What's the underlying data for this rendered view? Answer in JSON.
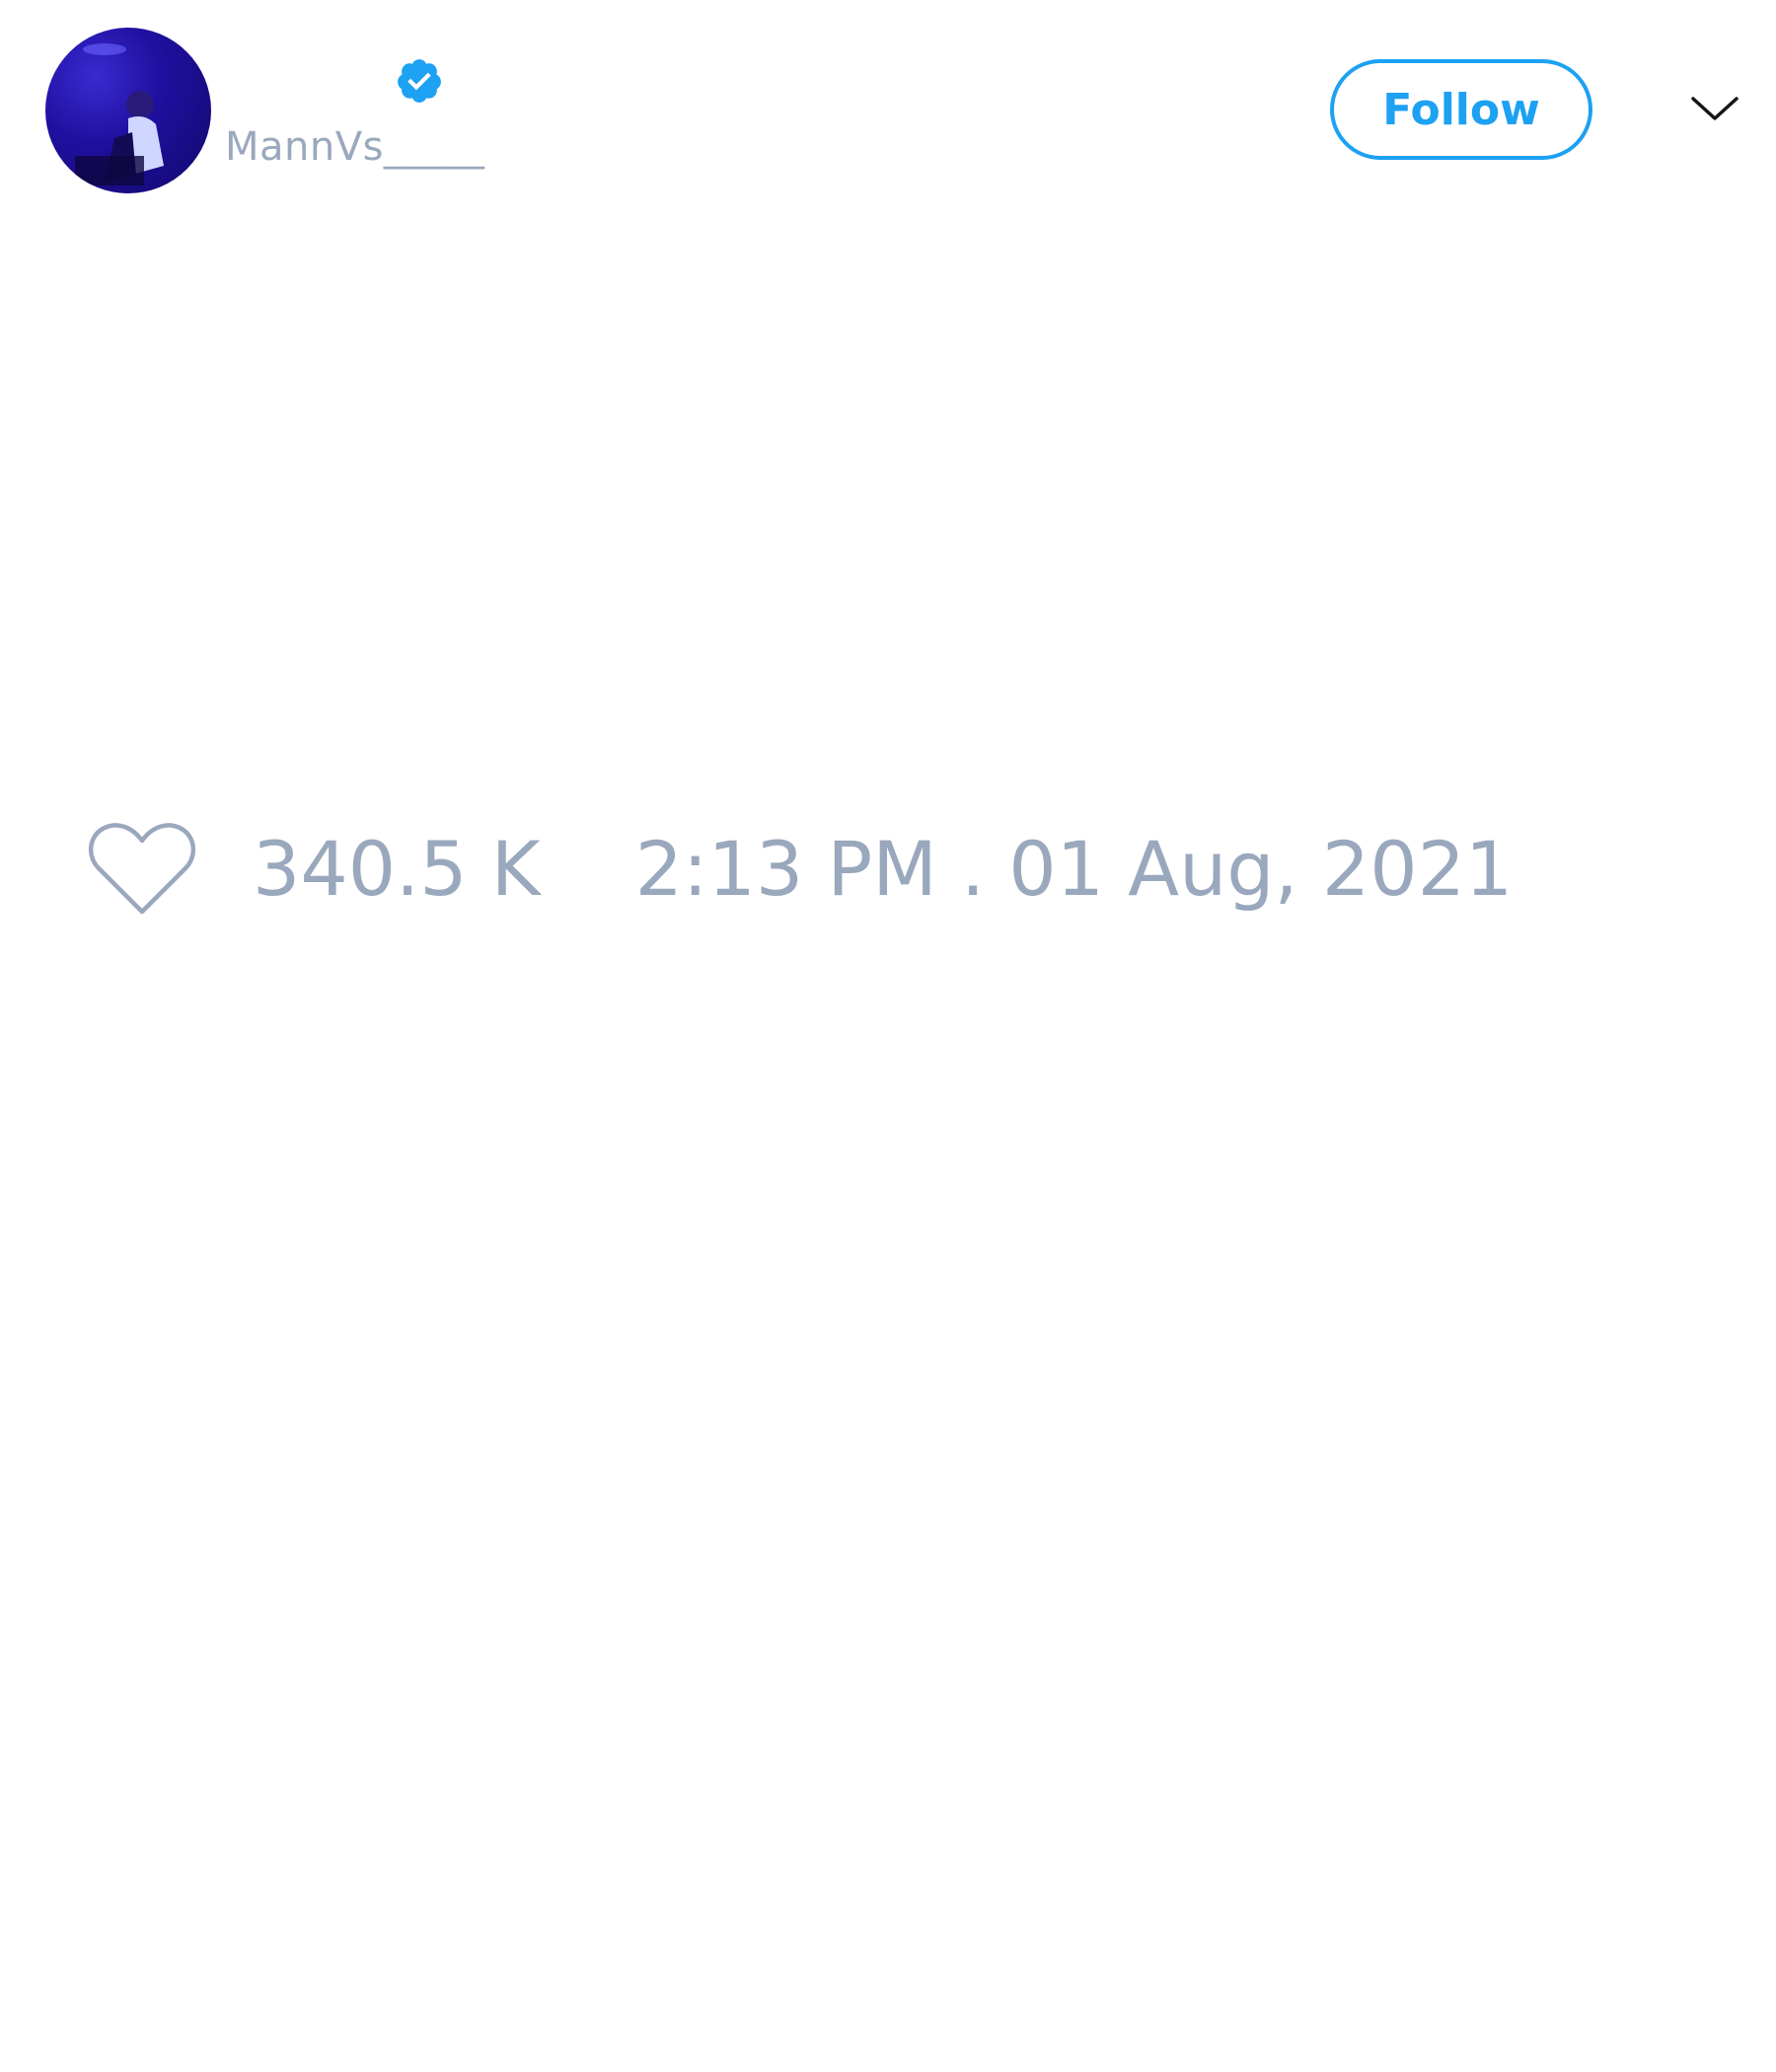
{
  "tweet": {
    "author": {
      "display_name": "",
      "handle": "MannVs_____",
      "verified": true,
      "avatar_icon": "profile-photo",
      "verified_icon": "verified-badge-icon"
    },
    "follow_label": "Follow",
    "menu_icon": "chevron-down-icon",
    "likes": {
      "icon": "heart-outline-icon",
      "count": "340.5 K"
    },
    "timestamp": "2:13 PM . 01 Aug, 2021"
  },
  "colors": {
    "accent": "#1da1f2",
    "muted_text": "#9aa8bd",
    "background": "#ffffff",
    "avatar_bg": "#2010a0"
  }
}
